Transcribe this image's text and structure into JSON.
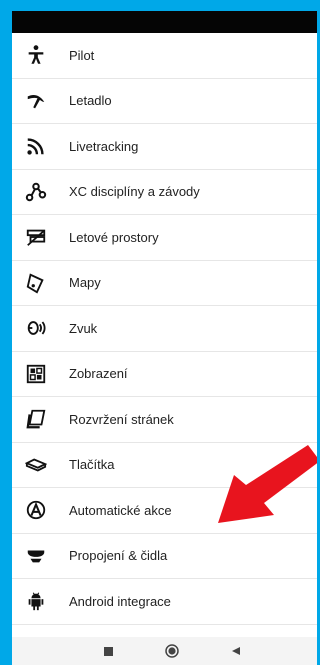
{
  "menu": {
    "items": [
      {
        "label": "Pilot",
        "icon": "person-icon"
      },
      {
        "label": "Letadlo",
        "icon": "glider-icon"
      },
      {
        "label": "Livetracking",
        "icon": "signal-icon"
      },
      {
        "label": "XC disciplíny a závody",
        "icon": "route-icon"
      },
      {
        "label": "Letové prostory",
        "icon": "airspace-icon"
      },
      {
        "label": "Mapy",
        "icon": "map-icon"
      },
      {
        "label": "Zvuk",
        "icon": "speaker-icon"
      },
      {
        "label": "Zobrazení",
        "icon": "display-grid-icon"
      },
      {
        "label": "Rozvržení stránek",
        "icon": "pages-icon"
      },
      {
        "label": "Tlačítka",
        "icon": "buttons-icon"
      },
      {
        "label": "Automatické akce",
        "icon": "auto-icon"
      },
      {
        "label": "Propojení & čidla",
        "icon": "sensor-icon"
      },
      {
        "label": "Android integrace",
        "icon": "android-icon"
      }
    ]
  },
  "colors": {
    "frame_background": "#00a8e8",
    "status_bar": "#050505",
    "annotation_arrow": "#e8141e",
    "text": "#222222"
  },
  "navigation": {
    "buttons": [
      "recent-apps-icon",
      "home-icon",
      "back-icon"
    ]
  }
}
